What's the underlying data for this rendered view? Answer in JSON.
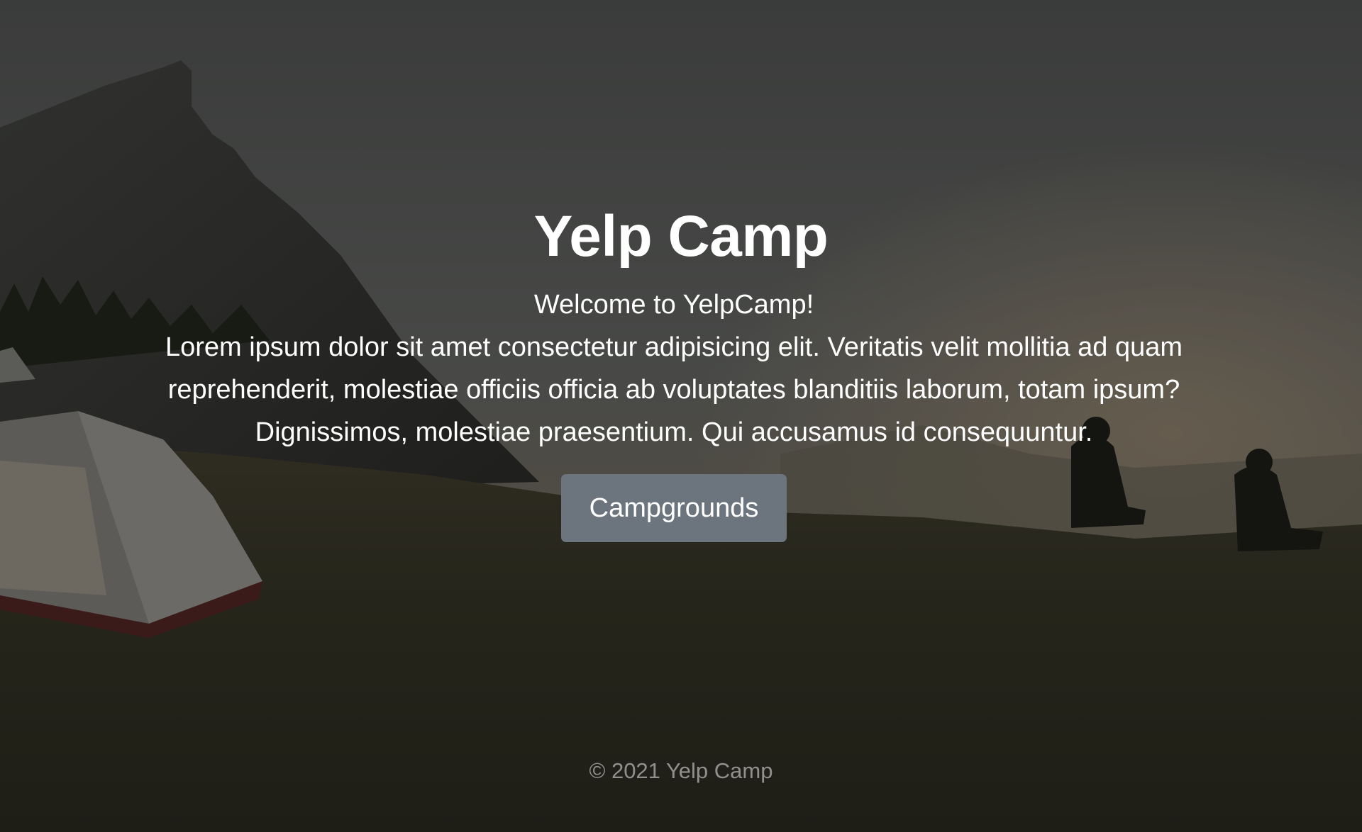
{
  "hero": {
    "title": "Yelp Camp",
    "welcome": "Welcome to YelpCamp!",
    "description": "Lorem ipsum dolor sit amet consectetur adipisicing elit. Veritatis velit mollitia ad quam reprehenderit, molestiae officiis officia ab voluptates blanditiis laborum, totam ipsum? Dignissimos, molestiae praesentium. Qui accusamus id consequuntur."
  },
  "actions": {
    "campgrounds_label": "Campgrounds"
  },
  "footer": {
    "copyright": "© 2021 Yelp Camp"
  },
  "colors": {
    "button_bg": "#6c757d",
    "text": "#ffffff",
    "footer_text": "rgba(255,255,255,0.5)"
  },
  "background": {
    "subject": "campsite-photo-with-mountain-tent-and-people-at-sunset"
  }
}
